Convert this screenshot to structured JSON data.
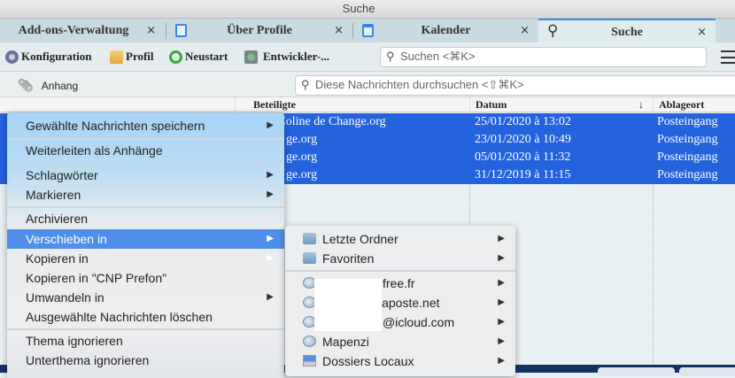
{
  "window": {
    "title": "Suche"
  },
  "tabs": [
    {
      "label": "Add-ons-Verwaltung",
      "close": "×",
      "icon": "puzzle-icon",
      "active": false
    },
    {
      "label": "Über Profile",
      "close": "×",
      "icon": "document-icon",
      "active": false
    },
    {
      "label": "Kalender",
      "close": "×",
      "icon": "calendar-icon",
      "active": false
    },
    {
      "label": "Suche",
      "close": "×",
      "icon": "search-icon",
      "active": true
    }
  ],
  "toolbar": {
    "buttons": [
      {
        "label": "Konfiguration",
        "icon": "gear-icon"
      },
      {
        "label": "Profil",
        "icon": "profile-folder-icon"
      },
      {
        "label": "Neustart",
        "icon": "restart-icon"
      },
      {
        "label": "Entwickler-...",
        "icon": "developer-icon"
      }
    ],
    "search_placeholder": "Suchen <⌘K>",
    "menu_icon": "hamburger-icon"
  },
  "filterbar": {
    "attachment_label": "Anhang",
    "search_placeholder": "Diese Nachrichten durchsuchen <⇧⌘K>"
  },
  "columns": {
    "participants": "Beteiligte",
    "date": "Datum",
    "sort_indicator": "↓",
    "location": "Ablageort"
  },
  "messages": [
    {
      "participants": "ata et Coline de Change.org",
      "date": "25/01/2020 à 13:02",
      "location": "Posteingang"
    },
    {
      "participants": "ge.org",
      "date": "23/01/2020 à 10:49",
      "location": "Posteingang"
    },
    {
      "participants": "ge.org",
      "date": "05/01/2020 à 11:32",
      "location": "Posteingang"
    },
    {
      "participants": "ge.org",
      "date": "31/12/2019 à 11:15",
      "location": "Posteingang"
    }
  ],
  "context_menu": {
    "items": [
      {
        "label": "Gewählte Nachrichten speichern",
        "submenu": true
      },
      {
        "label": "Weiterleiten als Anhänge",
        "submenu": false
      },
      {
        "label": "Schlagwörter",
        "submenu": true
      },
      {
        "label": "Markieren",
        "submenu": true
      },
      {
        "label": "Archivieren",
        "submenu": false
      },
      {
        "label": "Verschieben in",
        "submenu": true,
        "highlighted": true
      },
      {
        "label": "Kopieren in",
        "submenu": true
      },
      {
        "label": "Kopieren in \"CNP Prefon\"",
        "submenu": false
      },
      {
        "label": "Umwandeln in",
        "submenu": true
      },
      {
        "label": "Ausgewählte Nachrichten löschen",
        "submenu": false
      },
      {
        "label": "Thema ignorieren",
        "submenu": false
      },
      {
        "label": "Unterthema ignorieren",
        "submenu": false
      }
    ]
  },
  "submenu": {
    "items": [
      {
        "label": "Letzte Ordner",
        "icon": "folder-icon"
      },
      {
        "label": "Favoriten",
        "icon": "folder-icon"
      },
      {
        "label": "free.fr",
        "icon": "account-icon"
      },
      {
        "label": "laposte.net",
        "icon": "account-icon"
      },
      {
        "label": "@icloud.com",
        "icon": "account-icon"
      },
      {
        "label": "Mapenzi",
        "icon": "account-icon"
      },
      {
        "label": "Dossiers Locaux",
        "icon": "local-folders-icon"
      }
    ]
  },
  "arrow": "▶"
}
